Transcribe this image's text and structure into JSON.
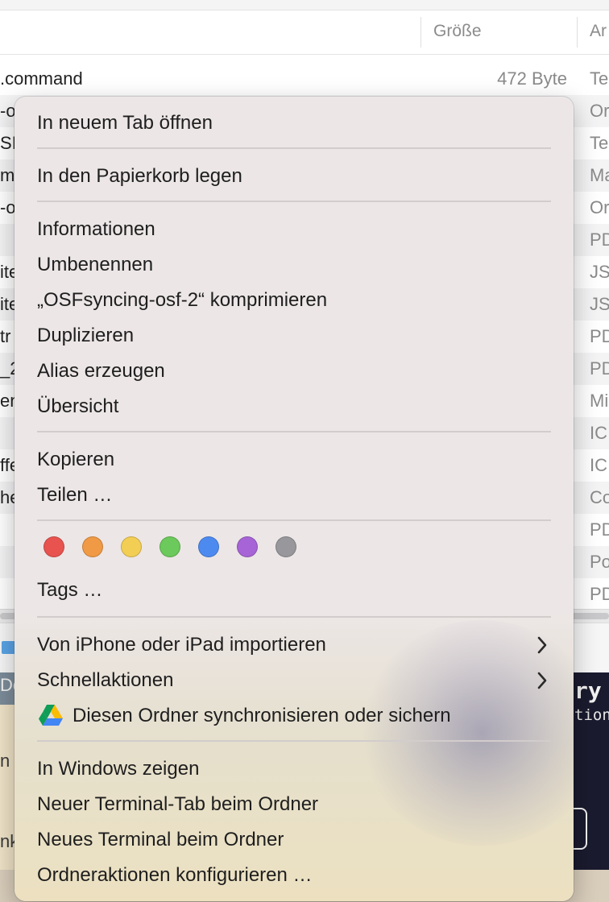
{
  "finder": {
    "columns": {
      "size": "Größe",
      "kind": "Ar"
    },
    "first_row": {
      "name": ".command",
      "size": "472 Byte",
      "kind": "Te"
    },
    "rows": [
      {
        "name": "-o",
        "kind": "Or"
      },
      {
        "name": "SI",
        "kind": "Te"
      },
      {
        "name": "me",
        "kind": "Ma"
      },
      {
        "name": "-o",
        "kind": "Or"
      },
      {
        "name": "",
        "kind": "PD"
      },
      {
        "name": "ite",
        "kind": "JS"
      },
      {
        "name": "ite",
        "kind": "JS"
      },
      {
        "name": "tr",
        "kind": "PD"
      },
      {
        "name": "_2",
        "kind": "PD"
      },
      {
        "name": "en",
        "kind": "Mi"
      },
      {
        "name": "",
        "kind": "IC"
      },
      {
        "name": "ffe",
        "kind": "IC"
      },
      {
        "name": "he",
        "kind": "Co"
      },
      {
        "name": "",
        "kind": "PD"
      },
      {
        "name": "",
        "kind": "Po"
      },
      {
        "name": "",
        "kind": "PD"
      }
    ],
    "path_fragment": "Dc",
    "desktop_fragments": [
      "n II",
      "nk"
    ],
    "terminal_fragments": [
      "ry",
      "tion"
    ]
  },
  "menu": {
    "open_in_new_tab": "In neuem Tab öffnen",
    "move_to_trash": "In den Papierkorb legen",
    "get_info": "Informationen",
    "rename": "Umbenennen",
    "compress": "„OSFsyncing-osf-2“ komprimieren",
    "duplicate": "Duplizieren",
    "make_alias": "Alias erzeugen",
    "quick_look": "Übersicht",
    "copy": "Kopieren",
    "share": "Teilen …",
    "tags": "Tags …",
    "import_from_iphone": "Von iPhone oder iPad importieren",
    "quick_actions": "Schnellaktionen",
    "sync_folder": "Diesen Ordner synchronisieren oder sichern",
    "show_in_windows": "In Windows zeigen",
    "new_terminal_tab": "Neuer Terminal-Tab beim Ordner",
    "new_terminal": "Neues Terminal beim Ordner",
    "folder_actions": "Ordneraktionen konfigurieren …"
  },
  "tag_colors": [
    "#e8534f",
    "#f09a45",
    "#f3ce55",
    "#6cc95b",
    "#4d8af0",
    "#a764d6",
    "#98989c"
  ],
  "accent": "#2d63c9"
}
